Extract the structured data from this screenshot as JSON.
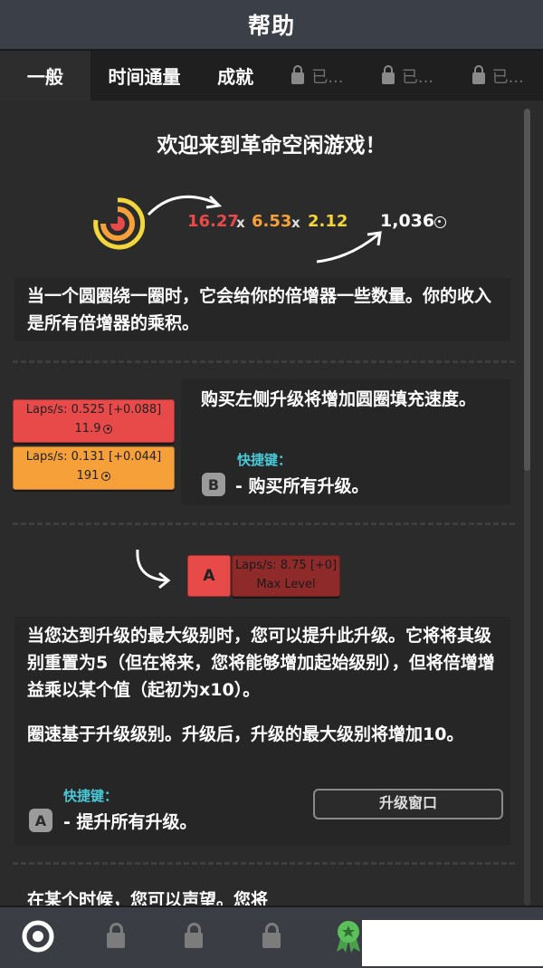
{
  "header": {
    "title": "帮助"
  },
  "tabs": [
    {
      "label": "一般"
    },
    {
      "label": "时间通量"
    },
    {
      "label": "成就"
    },
    {
      "label": "已..."
    },
    {
      "label": "已..."
    },
    {
      "label": "已..."
    }
  ],
  "welcome": {
    "title": "欢迎来到革命空闲游戏！",
    "formula": {
      "a": "16.27",
      "b": "6.53",
      "c": "2.12",
      "times": "x",
      "result": "1,036"
    },
    "description": "当一个圆圈绕一圈时，它会给你的倍增器一些数量。你的收入是所有倍增器的乘积。"
  },
  "upgrades": {
    "card1": {
      "line1": "Laps/s: 0.525 [+0.088]",
      "line2": "11.9"
    },
    "card2": {
      "line1": "Laps/s: 0.131 [+0.044]",
      "line2": "191"
    },
    "text": "购买左侧升级将增加圆圈填充速度。",
    "shortcut_label": "快捷键：",
    "key": "B",
    "key_desc": "- 购买所有升级。"
  },
  "prestige": {
    "key": "A",
    "card": {
      "line1": "Laps/s: 8.75 [+0]",
      "line2": "Max Level"
    },
    "text1": "当您达到升级的最大级别时，您可以提升此升级。它将将其级别重置为5（但在将来，您将能够增加起始级别），但将倍增增益乘以某个值（起初为x10）。",
    "text2": "圈速基于升级级别。升级后，升级的最大级别将增加10。",
    "shortcut_label": "快捷键：",
    "key_desc": "- 提升所有升级。"
  },
  "footer_teaser": {
    "text": "在某个时候，您可以声望。您将",
    "button": "升级窗口"
  },
  "colors": {
    "red": "#e84a4a",
    "orange": "#f6a03a",
    "yellow": "#f2d73c",
    "cyan": "#49c8d8"
  }
}
